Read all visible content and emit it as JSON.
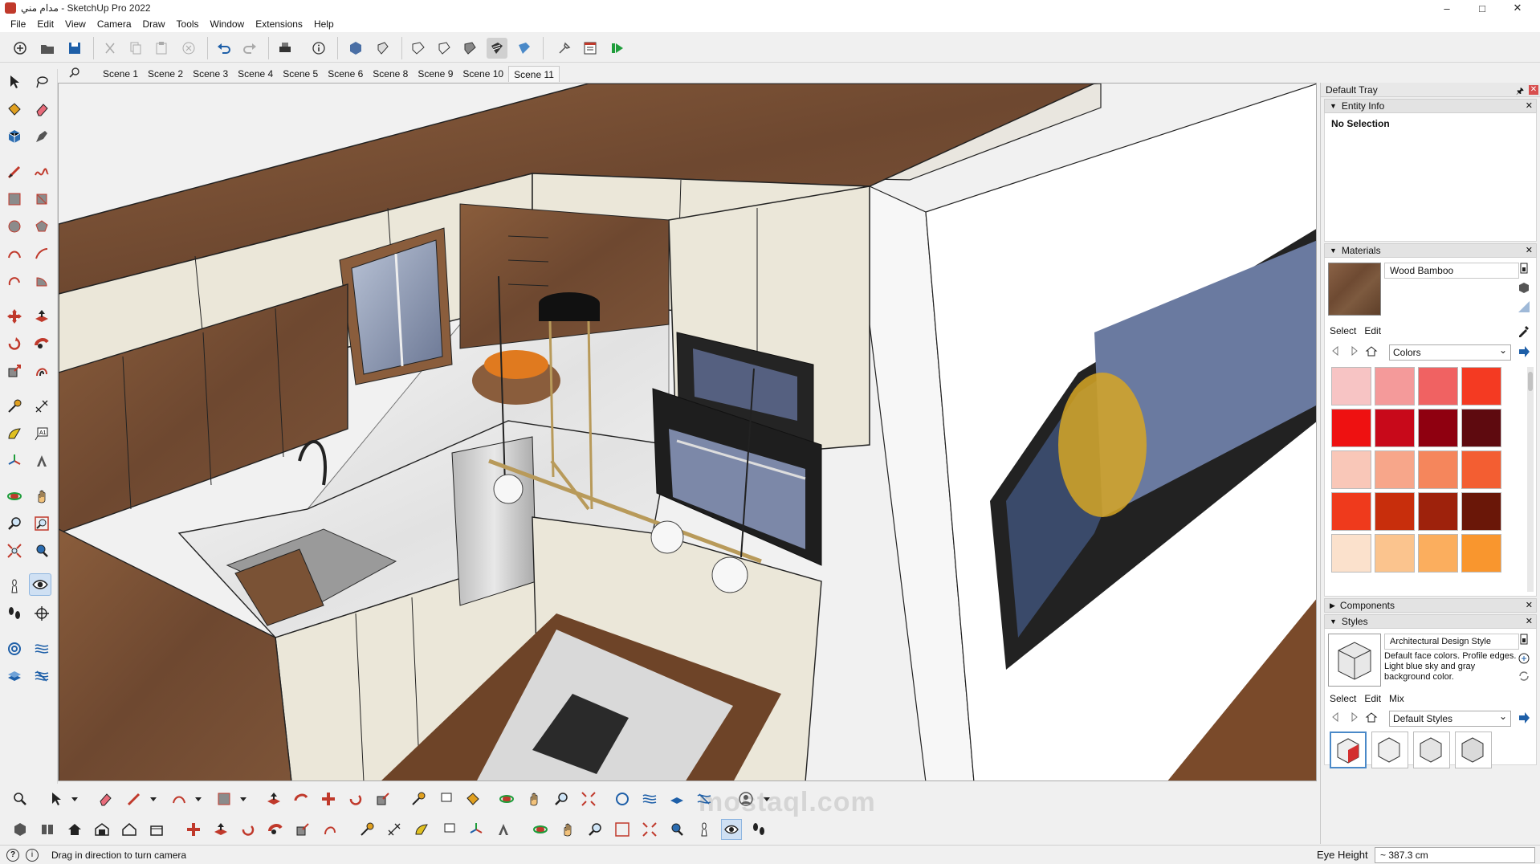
{
  "window": {
    "title": "مدام مني - SketchUp Pro 2022",
    "controls": [
      "–",
      "□",
      "✕"
    ]
  },
  "menubar": [
    "File",
    "Edit",
    "View",
    "Camera",
    "Draw",
    "Tools",
    "Window",
    "Extensions",
    "Help"
  ],
  "scenes": {
    "tabs": [
      "Scene 1",
      "Scene 2",
      "Scene 3",
      "Scene 4",
      "Scene 5",
      "Scene 6",
      "Scene 8",
      "Scene 9",
      "Scene 10",
      "Scene 11"
    ],
    "active": "Scene 11"
  },
  "status": {
    "hint": "Drag in direction to turn camera",
    "vcb_label": "Eye Height",
    "vcb_value": "~ 387.3 cm"
  },
  "watermark": "mostaql.com",
  "tray": {
    "title": "Default Tray",
    "entity_info": {
      "title": "Entity Info",
      "selection": "No Selection"
    },
    "materials": {
      "title": "Materials",
      "current": "Wood Bamboo",
      "tabs": [
        "Select",
        "Edit"
      ],
      "library": "Colors",
      "swatches": [
        "#f7c4c4",
        "#f49a9a",
        "#f06262",
        "#f43a22",
        "#ee1111",
        "#c8091a",
        "#8f0010",
        "#5e0a0f",
        "#f9c7b8",
        "#f7a68a",
        "#f5865c",
        "#f35e32",
        "#ef3a1c",
        "#c82e0c",
        "#9e220c",
        "#6a1708",
        "#fbe1cc",
        "#fbc48e",
        "#fbae5e",
        "#f9962e"
      ]
    },
    "components": {
      "title": "Components"
    },
    "styles": {
      "title": "Styles",
      "current": "Architectural Design Style",
      "description": "Default face colors. Profile edges. Light blue sky and gray background color.",
      "tabs": [
        "Select",
        "Edit",
        "Mix"
      ],
      "library": "Default Styles"
    }
  },
  "colors": {
    "wood": "#7a5235",
    "cabinet": "#ece8d8",
    "wall": "#f2f2f2",
    "accent": "#0078d7"
  }
}
